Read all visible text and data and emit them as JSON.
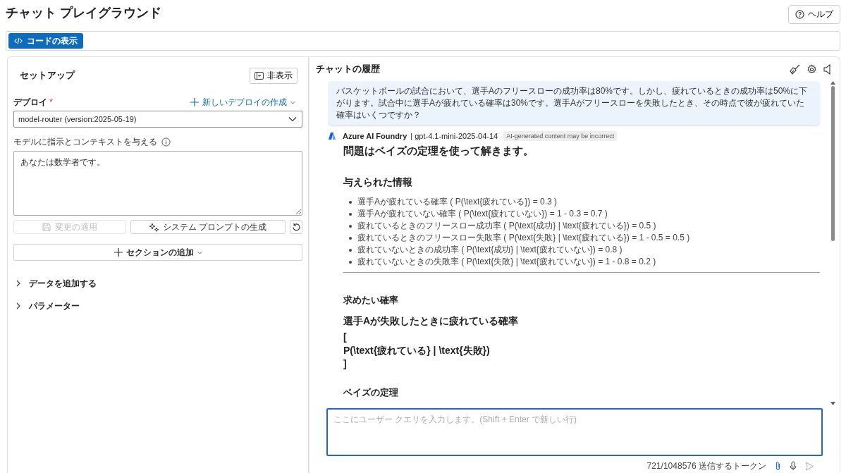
{
  "page": {
    "title": "チャット プレイグラウンド",
    "help_button": "ヘルプ"
  },
  "toolbar": {
    "view_code_button": "コードの表示"
  },
  "setup": {
    "title": "セットアップ",
    "hide_button": "非表示",
    "deploy": {
      "label": "デプロイ",
      "required": true,
      "required_mark": "*",
      "create_link": "新しいデプロイの作成",
      "value": "model-router (version:2025-05-19)"
    },
    "instructions": {
      "label": "モデルに指示とコンテキストを与える",
      "value": "あなたは数学者です。"
    },
    "apply_button": {
      "label": "変更の適用",
      "disabled": true
    },
    "generate_button": {
      "label": "システム プロンプトの生成",
      "disabled": false
    },
    "add_section_button": "セクションの追加",
    "sections": [
      {
        "label": "データを追加する",
        "expanded": false
      },
      {
        "label": "パラメーター",
        "expanded": false
      }
    ]
  },
  "chat": {
    "title": "チャットの履歴",
    "user_message": "バスケットボールの試合において、選手Aのフリースローの成功率は80%です。しかし、疲れているときの成功率は50%に下がります。試合中に選手Aが疲れている確率は30%です。選手Aがフリースローを失敗したとき、その時点で彼が疲れていた確率はいくつですか？",
    "reply": {
      "source": "Azure AI Foundry",
      "model": "| gpt-4.1-mini-2025-04-14",
      "notice": "AI-generated content may be incorrect",
      "blocks": [
        {
          "kind": "h1",
          "text": "問題はベイズの定理を使って解きます。"
        },
        {
          "kind": "h2",
          "text": "与えられた情報"
        },
        {
          "kind": "list",
          "items": [
            "選手Aが疲れている確率 ( P(\\text{疲れている}) = 0.3 )",
            "選手Aが疲れていない確率 ( P(\\text{疲れていない}) = 1 - 0.3 = 0.7 )",
            "疲れているときのフリースロー成功率 ( P(\\text{成功} | \\text{疲れている}) = 0.5 )",
            "疲れているときのフリースロー失敗率 ( P(\\text{失敗} | \\text{疲れている}) = 1 - 0.5 = 0.5 )",
            "疲れていないときの成功率 ( P(\\text{成功} | \\text{疲れていない}) = 0.8 )",
            "疲れていないときの失敗率 ( P(\\text{失敗} | \\text{疲れていない}) = 1 - 0.8 = 0.2 )"
          ]
        },
        {
          "kind": "rule"
        },
        {
          "kind": "h3",
          "text": "求めたい確率"
        },
        {
          "kind": "h2",
          "text": "選手Aが失敗したときに疲れている確率"
        },
        {
          "kind": "math",
          "lines": [
            "[",
            "P(\\text{疲れている} | \\text{失敗})",
            "]"
          ]
        },
        {
          "kind": "h3",
          "text": "ベイズの定理"
        }
      ]
    },
    "input": {
      "placeholder": "ここにユーザー クエリを入力します。(Shift + Enter で新しい行)"
    },
    "token_count": "721/1048576 送信するトークン"
  }
}
